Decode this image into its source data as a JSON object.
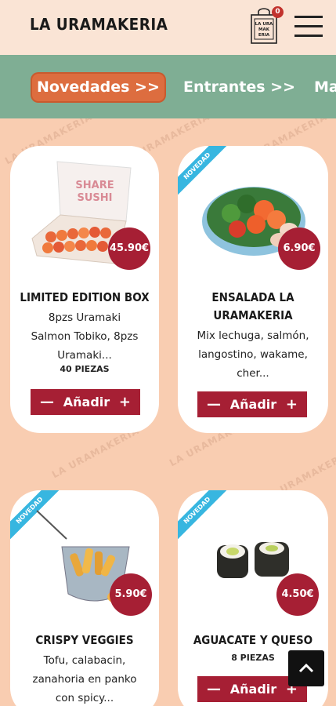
{
  "header": {
    "logo": "LA URAMAKERIA",
    "cart_count": "0",
    "cart_box_text": "LA URA MAK ERIA"
  },
  "categories": [
    {
      "label": "Novedades >>",
      "active": true
    },
    {
      "label": "Entrantes >>",
      "active": false
    },
    {
      "label": "Ma",
      "active": false
    }
  ],
  "watermark": "LA URAMAKERIA",
  "products": [
    {
      "name": "LIMITED EDITION BOX",
      "desc_lines": [
        "8pzs Uramaki",
        "Salmon Tobiko, 8pzs",
        "Uramaki..."
      ],
      "pieces": "40 PIEZAS",
      "price": "45.90€",
      "badge": "",
      "add_label": "Añadir",
      "image_text": [
        "SHARE",
        "SUSHI"
      ]
    },
    {
      "name_lines": [
        "ENSALADA LA",
        "URAMAKERIA"
      ],
      "desc_lines": [
        "Mix lechuga, salmón,",
        "langostino, wakame,",
        "cher..."
      ],
      "price": "6.90€",
      "badge": "NOVEDAD",
      "add_label": "Añadir"
    },
    {
      "name": "CRISPY VEGGIES",
      "desc_lines": [
        "Tofu, calabacin,",
        "zanahoria en panko",
        "con spicy..."
      ],
      "price": "5.90€",
      "badge": "NOVEDAD",
      "add_label": "Añadir"
    },
    {
      "name": "AGUACATE Y QUESO",
      "pieces": "8 PIEZAS",
      "price": "4.50€",
      "badge": "NOVEDAD",
      "add_label": "Añadir"
    }
  ],
  "colors": {
    "accent": "#a61f34",
    "category_bar": "#7fae94",
    "active_tab": "#dd6d3f",
    "badge": "#37b6e0",
    "background": "#f9cdb1"
  }
}
